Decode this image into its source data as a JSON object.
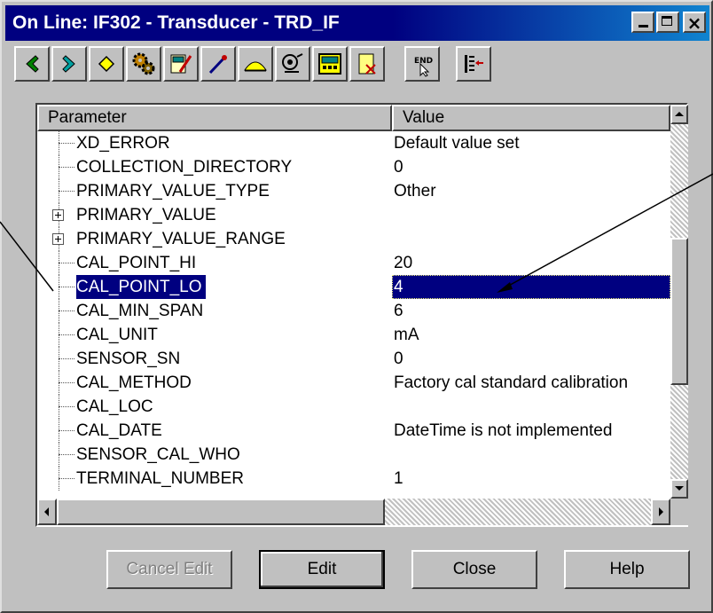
{
  "window": {
    "title": "On Line: IF302 - Transducer - TRD_IF"
  },
  "toolbar": {
    "buttons": [
      {
        "icon": "back-arrow-icon",
        "color": "#008000"
      },
      {
        "icon": "forward-arrow-icon",
        "color": "#00a0a0"
      },
      {
        "icon": "diamond-icon",
        "color": "#ffff00"
      },
      {
        "icon": "gears-icon",
        "color": "#c08000"
      },
      {
        "icon": "meter-edit-icon",
        "color": "#c0c000"
      },
      {
        "icon": "calibrate-icon",
        "color": "#c00000"
      },
      {
        "icon": "curve-icon",
        "color": "#ffff00"
      },
      {
        "icon": "sensor-icon",
        "color": "#808080"
      },
      {
        "icon": "device-display-icon",
        "color": "#ffff00"
      },
      {
        "icon": "document-icon",
        "color": "#ffff80"
      },
      {
        "icon": "end-icon",
        "color": "#000000"
      },
      {
        "icon": "list-insert-icon",
        "color": "#c00000"
      }
    ]
  },
  "table": {
    "columns": [
      "Parameter",
      "Value"
    ],
    "rows": [
      {
        "param": "XD_ERROR",
        "value": "Default value set",
        "expandable": false
      },
      {
        "param": "COLLECTION_DIRECTORY",
        "value": "0",
        "expandable": false
      },
      {
        "param": "PRIMARY_VALUE_TYPE",
        "value": "Other",
        "expandable": false
      },
      {
        "param": "PRIMARY_VALUE",
        "value": "",
        "expandable": true
      },
      {
        "param": "PRIMARY_VALUE_RANGE",
        "value": "",
        "expandable": true
      },
      {
        "param": "CAL_POINT_HI",
        "value": "20",
        "expandable": false
      },
      {
        "param": "CAL_POINT_LO",
        "value": "4",
        "expandable": false,
        "selected": true
      },
      {
        "param": "CAL_MIN_SPAN",
        "value": "6",
        "expandable": false
      },
      {
        "param": "CAL_UNIT",
        "value": "mA",
        "expandable": false
      },
      {
        "param": "SENSOR_SN",
        "value": "0",
        "expandable": false
      },
      {
        "param": "CAL_METHOD",
        "value": "Factory cal standard calibration",
        "expandable": false
      },
      {
        "param": "CAL_LOC",
        "value": "",
        "expandable": false
      },
      {
        "param": "CAL_DATE",
        "value": "DateTime is not implemented",
        "expandable": false
      },
      {
        "param": "SENSOR_CAL_WHO",
        "value": "",
        "expandable": false
      },
      {
        "param": "TERMINAL_NUMBER",
        "value": "1",
        "expandable": false
      }
    ]
  },
  "buttons": {
    "cancel_edit": "Cancel Edit",
    "edit": "Edit",
    "close": "Close",
    "help": "Help"
  },
  "scroll": {
    "vertical_position": 0.5,
    "horizontal_position": 0.0
  },
  "colors": {
    "title_bar": "#000080",
    "selection": "#000080",
    "face": "#c0c0c0"
  }
}
